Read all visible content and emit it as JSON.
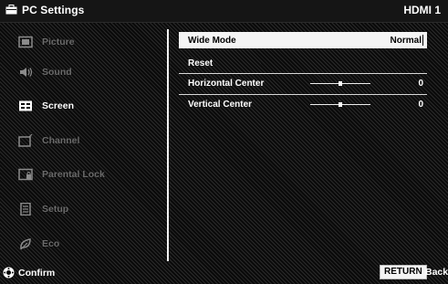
{
  "header": {
    "icon": "briefcase-icon",
    "title": "PC Settings",
    "input": "HDMI 1"
  },
  "sidebar": {
    "items": [
      {
        "label": "Picture",
        "icon": "picture-icon",
        "active": false
      },
      {
        "label": "Sound",
        "icon": "speaker-icon",
        "active": false
      },
      {
        "label": "Screen",
        "icon": "screen-icon",
        "active": true
      },
      {
        "label": "Channel",
        "icon": "channel-icon",
        "active": false
      },
      {
        "label": "Parental Lock",
        "icon": "lock-icon",
        "active": false
      },
      {
        "label": "Setup",
        "icon": "setup-icon",
        "active": false
      },
      {
        "label": "Eco",
        "icon": "eco-leaf-icon",
        "active": false
      }
    ]
  },
  "menu": {
    "wide_mode": {
      "label": "Wide Mode",
      "value": "Normal"
    },
    "reset": {
      "label": "Reset"
    },
    "horizontal_center": {
      "label": "Horizontal Center",
      "value": "0",
      "level": 0.5
    },
    "vertical_center": {
      "label": "Vertical Center",
      "value": "0",
      "level": 0.5
    }
  },
  "footer": {
    "confirm_icon": "confirm-button-icon",
    "confirm_label": "Confirm",
    "return_label": "RETURN",
    "back_label": "Back"
  },
  "colors": {
    "highlight": "#f4f4f4",
    "text": "#ffffff",
    "inactive_text": "#8a8a8a"
  }
}
